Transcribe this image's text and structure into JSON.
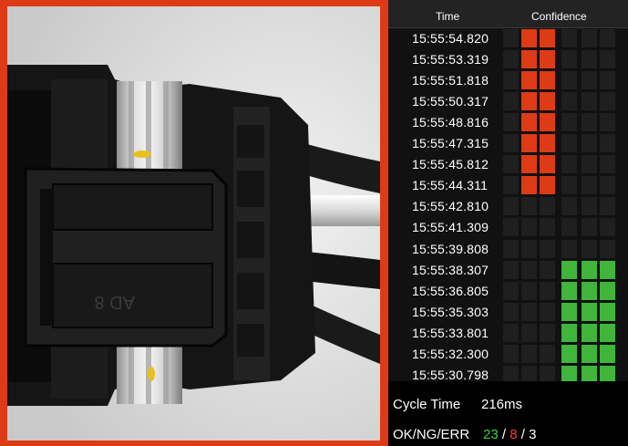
{
  "viewer": {
    "frame_color": "#dd3b16",
    "image_subject": "connector-part-grayscale-camera-image",
    "part_marking": "AD 8"
  },
  "table": {
    "headers": {
      "time": "Time",
      "confidence": "Confidence"
    },
    "colors": {
      "ng": "#dd3b16",
      "ok": "#3fb53c",
      "empty": "#1f1f1f"
    },
    "rows": [
      {
        "time": "15:55:54.820",
        "ng_level": 2,
        "ok_level": 0
      },
      {
        "time": "15:55:53.319",
        "ng_level": 2,
        "ok_level": 0
      },
      {
        "time": "15:55:51.818",
        "ng_level": 2,
        "ok_level": 0
      },
      {
        "time": "15:55:50.317",
        "ng_level": 2,
        "ok_level": 0
      },
      {
        "time": "15:55:48.816",
        "ng_level": 2,
        "ok_level": 0
      },
      {
        "time": "15:55:47.315",
        "ng_level": 2,
        "ok_level": 0
      },
      {
        "time": "15:55:45.812",
        "ng_level": 2,
        "ok_level": 0
      },
      {
        "time": "15:55:44.311",
        "ng_level": 2,
        "ok_level": 0
      },
      {
        "time": "15:55:42.810",
        "ng_level": 0,
        "ok_level": 0
      },
      {
        "time": "15:55:41.309",
        "ng_level": 0,
        "ok_level": 0
      },
      {
        "time": "15:55:39.808",
        "ng_level": 0,
        "ok_level": 0
      },
      {
        "time": "15:55:38.307",
        "ng_level": 0,
        "ok_level": 3
      },
      {
        "time": "15:55:36.805",
        "ng_level": 0,
        "ok_level": 3
      },
      {
        "time": "15:55:35.303",
        "ng_level": 0,
        "ok_level": 3
      },
      {
        "time": "15:55:33.801",
        "ng_level": 0,
        "ok_level": 3
      },
      {
        "time": "15:55:32.300",
        "ng_level": 0,
        "ok_level": 3
      },
      {
        "time": "15:55:30.798",
        "ng_level": 0,
        "ok_level": 3
      }
    ]
  },
  "footer": {
    "cycle_time_label": "Cycle Time",
    "cycle_time_value": "216ms",
    "counts_label": "OK/NG/ERR",
    "ok_count": "23",
    "ng_count": "8",
    "err_count": "3",
    "sep1": " / ",
    "sep2": " / "
  }
}
